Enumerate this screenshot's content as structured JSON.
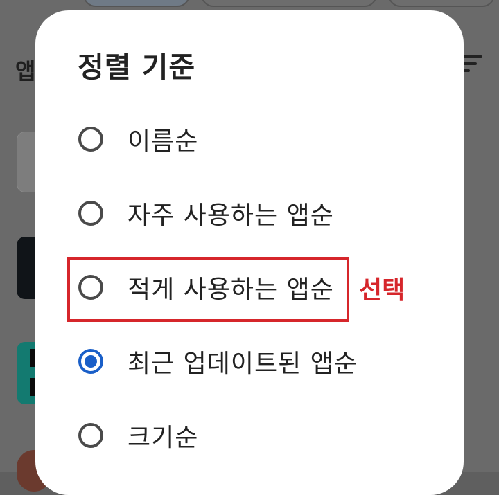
{
  "background": {
    "section_label": "앱"
  },
  "dialog": {
    "title": "정렬 기준",
    "options": [
      {
        "label": "이름순",
        "checked": false
      },
      {
        "label": "자주 사용하는 앱순",
        "checked": false
      },
      {
        "label": "적게 사용하는 앱순",
        "checked": false
      },
      {
        "label": "최근 업데이트된 앱순",
        "checked": true
      },
      {
        "label": "크기순",
        "checked": false
      }
    ]
  },
  "annotation": {
    "label": "선택",
    "color": "#d6262b"
  },
  "colors": {
    "accent": "#1a5fc8",
    "dialog_bg": "#ffffff",
    "scrim": "#6a6a6a"
  }
}
